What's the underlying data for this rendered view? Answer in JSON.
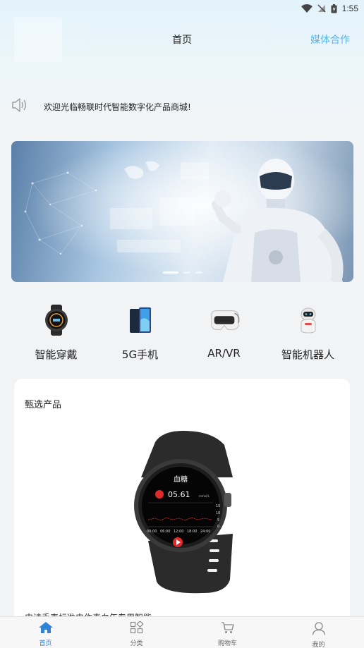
{
  "status_bar": {
    "time": "1:55"
  },
  "header": {
    "title": "首页",
    "media_link": "媒体合作"
  },
  "notice": {
    "text": "欢迎光临畅联时代智能数字化产品商城!"
  },
  "banner": {
    "slides": 3,
    "active_slide": 1
  },
  "categories": [
    {
      "label": "智能穿戴",
      "icon": "smartwatch-icon"
    },
    {
      "label": "5G手机",
      "icon": "phone-icon"
    },
    {
      "label": "AR/VR",
      "icon": "vr-headset-icon"
    },
    {
      "label": "智能机器人",
      "icon": "robot-icon"
    }
  ],
  "featured": {
    "title": "甄选产品",
    "product_name": "史诗手表标准电作毒血年专用智能",
    "watch_screen": {
      "title": "血糖",
      "value": "05.61",
      "unit": "mmol/L",
      "axis_labels": [
        "15",
        "10",
        "5",
        "0"
      ],
      "time_labels": [
        "00:00",
        "06:00",
        "12:00",
        "18:00",
        "24:00"
      ]
    }
  },
  "tabbar": {
    "items": [
      {
        "label": "首页",
        "icon": "home-icon",
        "active": true
      },
      {
        "label": "分类",
        "icon": "category-icon",
        "active": false
      },
      {
        "label": "购物车",
        "icon": "cart-icon",
        "active": false
      },
      {
        "label": "我的",
        "icon": "profile-icon",
        "active": false
      }
    ]
  },
  "colors": {
    "accent": "#57b7e8",
    "tab_active": "#2f83d6"
  }
}
